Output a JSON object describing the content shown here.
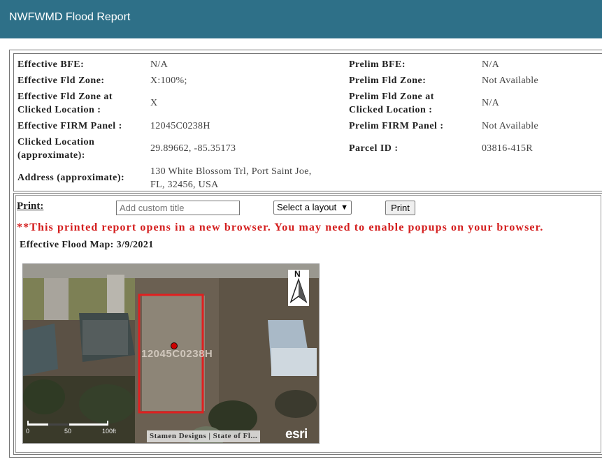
{
  "header": {
    "title": "NWFWMD Flood Report"
  },
  "info": {
    "effective_bfe_label": "Effective BFE:",
    "effective_bfe_value": "N/A",
    "effective_fld_zone_label": "Effective Fld Zone:",
    "effective_fld_zone_value": "X:100%;",
    "effective_fld_zone_clicked_label_1": "Effective Fld Zone at",
    "effective_fld_zone_clicked_label_2": "Clicked Location :",
    "effective_fld_zone_clicked_value": "X",
    "effective_firm_panel_label": "Effective FIRM Panel :",
    "effective_firm_panel_value": "12045C0238H",
    "clicked_location_label_1": "Clicked Location",
    "clicked_location_label_2": "(approximate):",
    "clicked_location_value": "29.89662,  -85.35173",
    "address_label": "Address (approximate):",
    "address_value_1": "130 White Blossom Trl, Port Saint Joe,",
    "address_value_2": "FL, 32456, USA",
    "prelim_bfe_label": "Prelim BFE:",
    "prelim_bfe_value": "N/A",
    "prelim_fld_zone_label": "Prelim Fld Zone:",
    "prelim_fld_zone_value": "Not Available",
    "prelim_fld_zone_clicked_label_1": "Prelim Fld Zone at",
    "prelim_fld_zone_clicked_label_2": "Clicked Location :",
    "prelim_fld_zone_clicked_value": "N/A",
    "prelim_firm_panel_label": "Prelim FIRM Panel :",
    "prelim_firm_panel_value": "Not Available",
    "parcel_id_label": "Parcel ID :",
    "parcel_id_value": "03816-415R"
  },
  "print": {
    "label": "Print:",
    "title_placeholder": "Add custom title",
    "layout_selected": "Select a layout",
    "print_button": "Print",
    "warning": "**This printed report opens in a new browser. You may need to enable popups on your browser."
  },
  "map": {
    "caption": "Effective Flood Map: 3/9/2021",
    "panel_label": "12045C0238H",
    "attribution": "Stamen Designs | State of Fl...",
    "esri_logo": "esri",
    "north_label": "N",
    "scale_0": "0",
    "scale_50": "50",
    "scale_100": "100ft",
    "colors": {
      "parcel_outline": "#e02020",
      "marker": "#cc0000",
      "header": "#2e7088"
    }
  }
}
